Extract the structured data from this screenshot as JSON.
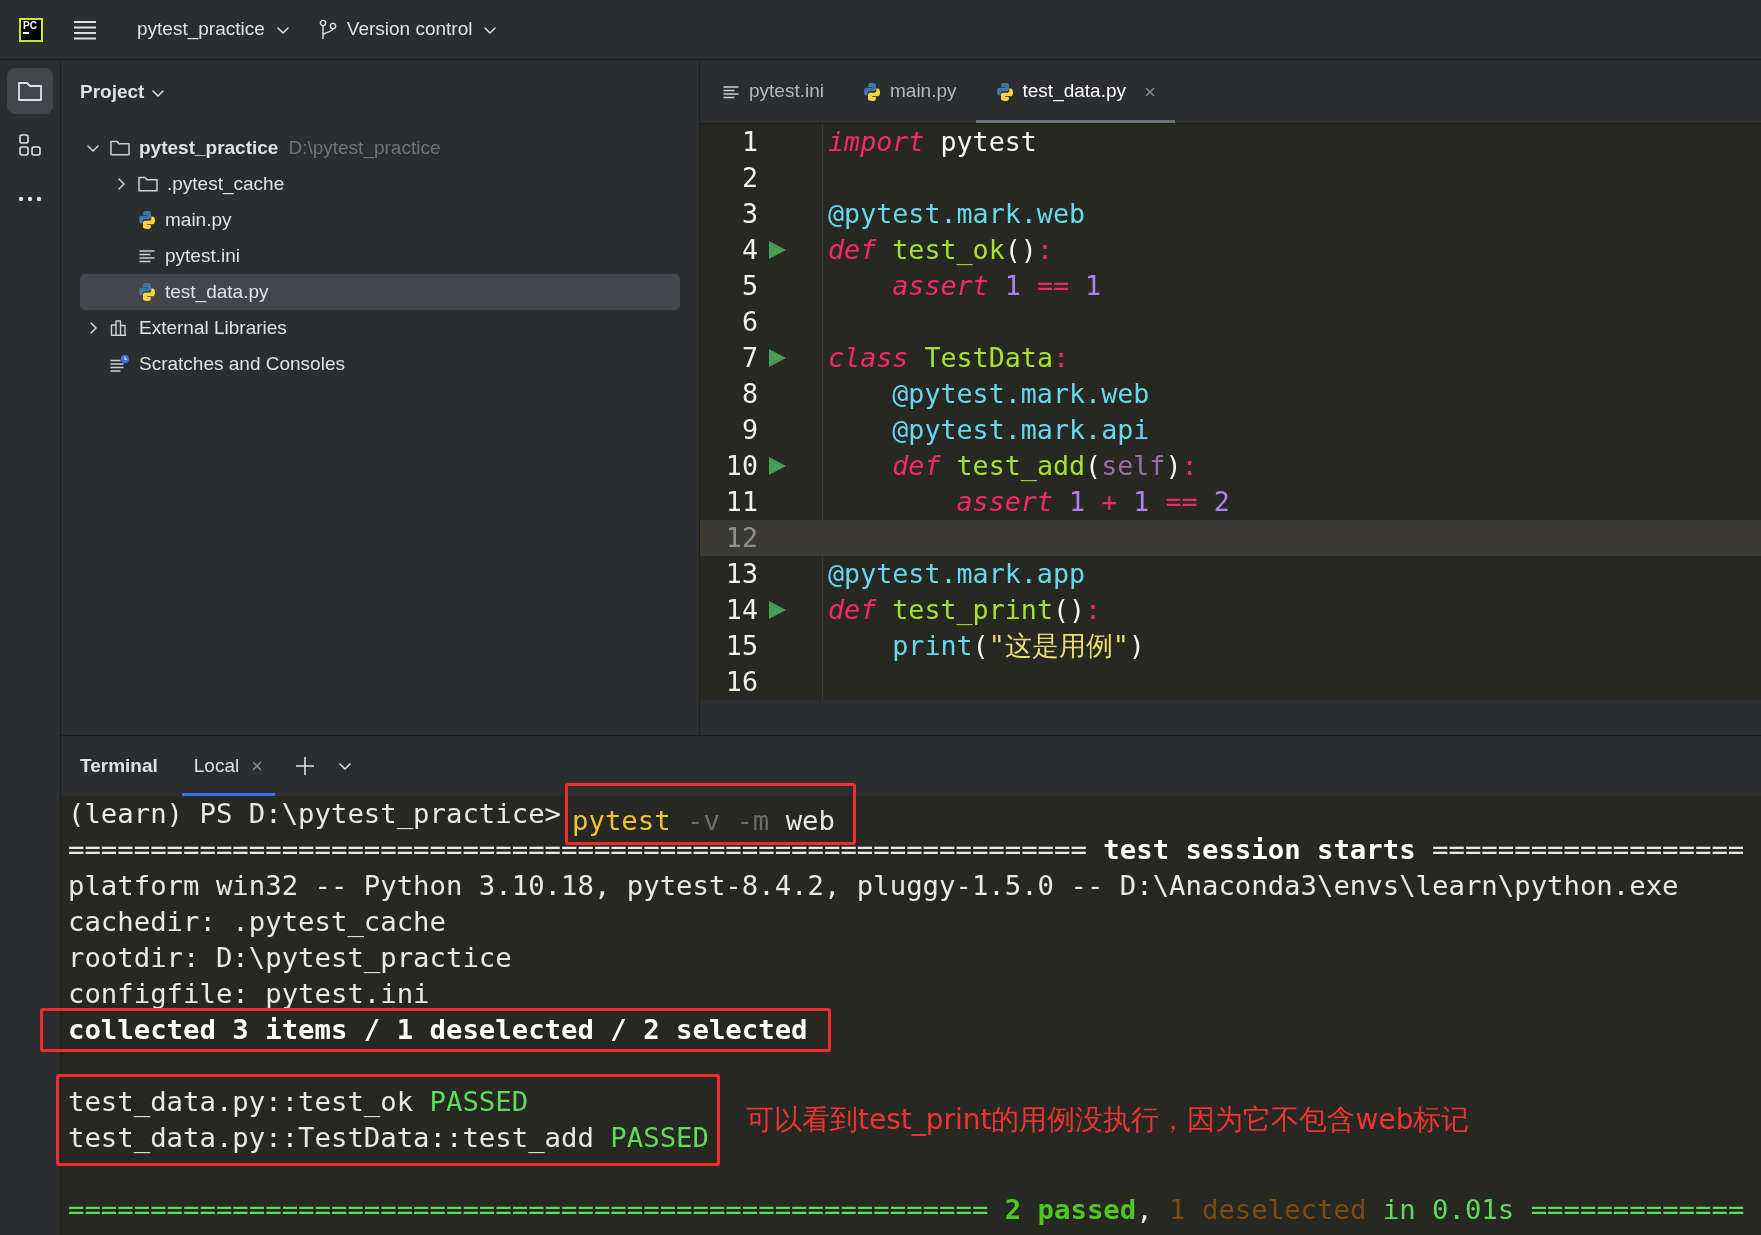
{
  "top_bar": {
    "logo_text": "PC",
    "project": "pytest_practice",
    "vcs": "Version control"
  },
  "tool_strip": [
    {
      "kind": "project",
      "selected": true
    },
    {
      "kind": "structure",
      "selected": false
    },
    {
      "kind": "more",
      "selected": false
    }
  ],
  "project_panel": {
    "title": "Project",
    "tree": [
      {
        "label": "pytest_practice",
        "path": "D:\\pytest_practice",
        "kind": "folder",
        "expanded": true,
        "selected": false,
        "children": [
          {
            "label": ".pytest_cache",
            "kind": "folder",
            "expanded": false,
            "selected": false
          },
          {
            "label": "main.py",
            "kind": "python",
            "selected": false
          },
          {
            "label": "pytest.ini",
            "kind": "ini",
            "selected": false
          },
          {
            "label": "test_data.py",
            "kind": "python",
            "selected": true
          }
        ]
      },
      {
        "label": "External Libraries",
        "kind": "library",
        "expanded": false,
        "selected": false
      },
      {
        "label": "Scratches and Consoles",
        "kind": "scratches",
        "selected": false
      }
    ]
  },
  "editor": {
    "tabs": [
      {
        "label": "pytest.ini",
        "kind": "ini",
        "selected": false
      },
      {
        "label": "main.py",
        "kind": "python",
        "selected": false
      },
      {
        "label": "test_data.py",
        "kind": "python",
        "selected": true
      }
    ],
    "lines": [
      {
        "number": "1",
        "run": false,
        "current": false,
        "tokens": [
          {
            "text": "import",
            "kind": "keyword"
          },
          {
            "text": " pytest",
            "kind": "plain"
          }
        ]
      },
      {
        "number": "2",
        "run": false,
        "current": false
      },
      {
        "number": "3",
        "run": false,
        "current": false,
        "tokens": [
          {
            "text": "@pytest.mark.web",
            "kind": "decorator"
          }
        ]
      },
      {
        "number": "4",
        "run": true,
        "current": false,
        "tokens": [
          {
            "text": "def",
            "kind": "keyword"
          },
          {
            "text": " test_ok",
            "kind": "func"
          },
          {
            "text": "()",
            "kind": "plain"
          },
          {
            "text": ":",
            "kind": "op"
          }
        ]
      },
      {
        "number": "5",
        "run": false,
        "current": false,
        "tokens": [
          {
            "text": "    assert",
            "kind": "keyword"
          },
          {
            "text": " 1",
            "kind": "number"
          },
          {
            "text": " ==",
            "kind": "op"
          },
          {
            "text": " 1",
            "kind": "number"
          }
        ]
      },
      {
        "number": "6",
        "run": false,
        "current": false
      },
      {
        "number": "7",
        "run": true,
        "current": false,
        "tokens": [
          {
            "text": "class",
            "kind": "keyword"
          },
          {
            "text": " TestData",
            "kind": "func"
          },
          {
            "text": ":",
            "kind": "op"
          }
        ]
      },
      {
        "number": "8",
        "run": false,
        "current": false,
        "tokens": [
          {
            "text": "    @pytest.mark.web",
            "kind": "decorator"
          }
        ]
      },
      {
        "number": "9",
        "run": false,
        "current": false,
        "tokens": [
          {
            "text": "    @pytest.mark.api",
            "kind": "decorator"
          }
        ]
      },
      {
        "number": "10",
        "run": true,
        "current": false,
        "tokens": [
          {
            "text": "    def",
            "kind": "keyword"
          },
          {
            "text": " test_add",
            "kind": "func"
          },
          {
            "text": "(",
            "kind": "plain"
          },
          {
            "text": "self",
            "kind": "self"
          },
          {
            "text": ")",
            "kind": "plain"
          },
          {
            "text": ":",
            "kind": "op"
          }
        ]
      },
      {
        "number": "11",
        "run": false,
        "current": false,
        "tokens": [
          {
            "text": "        assert",
            "kind": "keyword"
          },
          {
            "text": " 1",
            "kind": "number"
          },
          {
            "text": " +",
            "kind": "op"
          },
          {
            "text": " 1",
            "kind": "number"
          },
          {
            "text": " ==",
            "kind": "op"
          },
          {
            "text": " 2",
            "kind": "number"
          }
        ]
      },
      {
        "number": "12",
        "run": false,
        "current": true
      },
      {
        "number": "13",
        "run": false,
        "current": false,
        "tokens": [
          {
            "text": "@pytest.mark.app",
            "kind": "decorator"
          }
        ]
      },
      {
        "number": "14",
        "run": true,
        "current": false,
        "tokens": [
          {
            "text": "def",
            "kind": "keyword"
          },
          {
            "text": " test_print",
            "kind": "func"
          },
          {
            "text": "()",
            "kind": "plain"
          },
          {
            "text": ":",
            "kind": "op"
          }
        ]
      },
      {
        "number": "15",
        "run": false,
        "current": false,
        "tokens": [
          {
            "text": "    print",
            "kind": "builtin"
          },
          {
            "text": "(",
            "kind": "plain"
          },
          {
            "text": "\"这是用例\"",
            "kind": "string"
          },
          {
            "text": ")",
            "kind": "plain"
          }
        ]
      },
      {
        "number": "16",
        "run": false,
        "current": false
      }
    ]
  },
  "terminal": {
    "title": "Terminal",
    "tabs": [
      {
        "label": "Local",
        "selected": true
      }
    ],
    "prompt": "(learn) PS D:\\pytest_practice>",
    "command": [
      {
        "text": "pytest",
        "kind": "exe"
      },
      {
        "text": " -v -m",
        "kind": "flag"
      },
      {
        "text": " web",
        "kind": "plain"
      }
    ],
    "command_boxed": true,
    "output": [
      {
        "kind": "line",
        "boxed": false,
        "spans": [
          {
            "text": "============================================================== ",
            "kind": "plain"
          },
          {
            "text": "test session starts",
            "kind": "bold"
          },
          {
            "text": " ===================",
            "kind": "plain"
          }
        ]
      },
      {
        "kind": "line",
        "boxed": false,
        "spans": [
          {
            "text": "platform win32 -- Python 3.10.18, pytest-8.4.2, pluggy-1.5.0 -- D:\\Anaconda3\\envs\\learn\\python.exe",
            "kind": "plain"
          }
        ]
      },
      {
        "kind": "line",
        "boxed": false,
        "spans": [
          {
            "text": "cachedir: .pytest_cache",
            "kind": "plain"
          }
        ]
      },
      {
        "kind": "line",
        "boxed": false,
        "spans": [
          {
            "text": "rootdir: D:\\pytest_practice",
            "kind": "plain"
          }
        ]
      },
      {
        "kind": "line",
        "boxed": false,
        "spans": [
          {
            "text": "configfile: pytest.ini",
            "kind": "plain"
          }
        ]
      },
      {
        "kind": "line",
        "boxed": true,
        "spans": [
          {
            "text": "collected 3 items / 1 deselected / 2 selected",
            "kind": "bold"
          }
        ]
      },
      {
        "kind": "blank"
      },
      {
        "kind": "group",
        "boxed": true,
        "note": "可以看到test_print的用例没执行，因为它不包含web标记",
        "lines": [
          {
            "spans": [
              {
                "text": "test_data.py::test_ok ",
                "kind": "plain"
              },
              {
                "text": "PASSED",
                "kind": "pass"
              }
            ]
          },
          {
            "spans": [
              {
                "text": "test_data.py::TestData::test_add ",
                "kind": "plain"
              },
              {
                "text": "PASSED",
                "kind": "pass"
              }
            ]
          }
        ]
      },
      {
        "kind": "blank"
      },
      {
        "kind": "line",
        "boxed": false,
        "spans": [
          {
            "text": "======================================================== ",
            "kind": "rule"
          },
          {
            "text": "2 passed",
            "kind": "summary"
          },
          {
            "text": ", ",
            "kind": "plain"
          },
          {
            "text": "1 deselected",
            "kind": "muted"
          },
          {
            "text": " in 0.01s =============",
            "kind": "rule"
          }
        ]
      }
    ]
  }
}
